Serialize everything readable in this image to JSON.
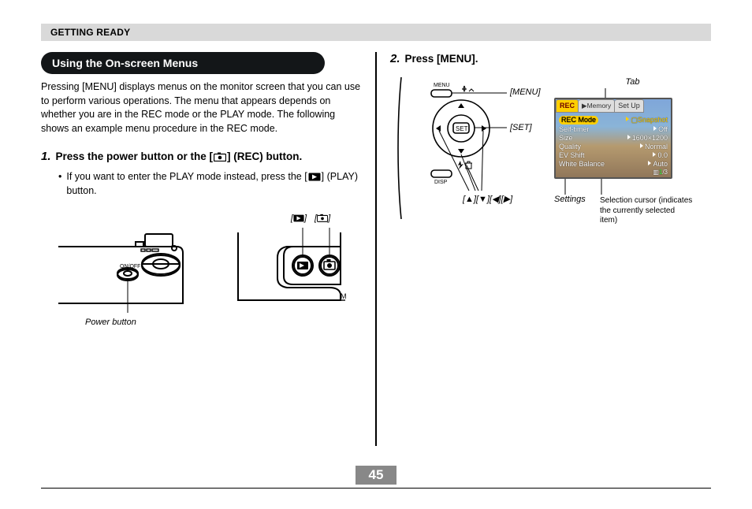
{
  "header": "GETTING READY",
  "section_title": "Using the On-screen Menus",
  "intro": "Pressing [MENU] displays menus on the monitor screen that you can use to perform various operations. The menu that appears depends on whether you are in the REC mode or the PLAY mode. The following shows an example menu procedure in the REC mode.",
  "step1": {
    "num": "1.",
    "text_pre": "Press the power button or the [",
    "text_post": "] (REC) button."
  },
  "step1_bullet": {
    "pre": "If you want to enter the PLAY mode instead, press the [",
    "post": "] (PLAY) button."
  },
  "power_label": "Power button",
  "step2": {
    "num": "2.",
    "text": "Press [MENU]."
  },
  "dpad": {
    "menu": "[MENU]",
    "set": "[SET]",
    "arrows": "[▲][▼][◀][▶]"
  },
  "annotation": {
    "tab": "Tab",
    "settings": "Settings",
    "cursor": "Selection cursor (indicates the currently selected item)"
  },
  "screen": {
    "tabs": [
      "REC",
      "Memory",
      "Set Up"
    ],
    "rows": [
      {
        "k": "REC Mode",
        "v": "Snapshot",
        "selected": true,
        "icon": "box"
      },
      {
        "k": "Self-timer",
        "v": "Off"
      },
      {
        "k": "Size",
        "v": "1600×1200"
      },
      {
        "k": "Quality",
        "v": "Normal"
      },
      {
        "k": "EV Shift",
        "v": "0.0"
      },
      {
        "k": "White Balance",
        "v": "Auto"
      }
    ],
    "page_indicator": {
      "current": "1",
      "total": "/3"
    }
  },
  "icons": {
    "rec": "camera-icon",
    "play": "play-icon"
  },
  "page_number": "45"
}
